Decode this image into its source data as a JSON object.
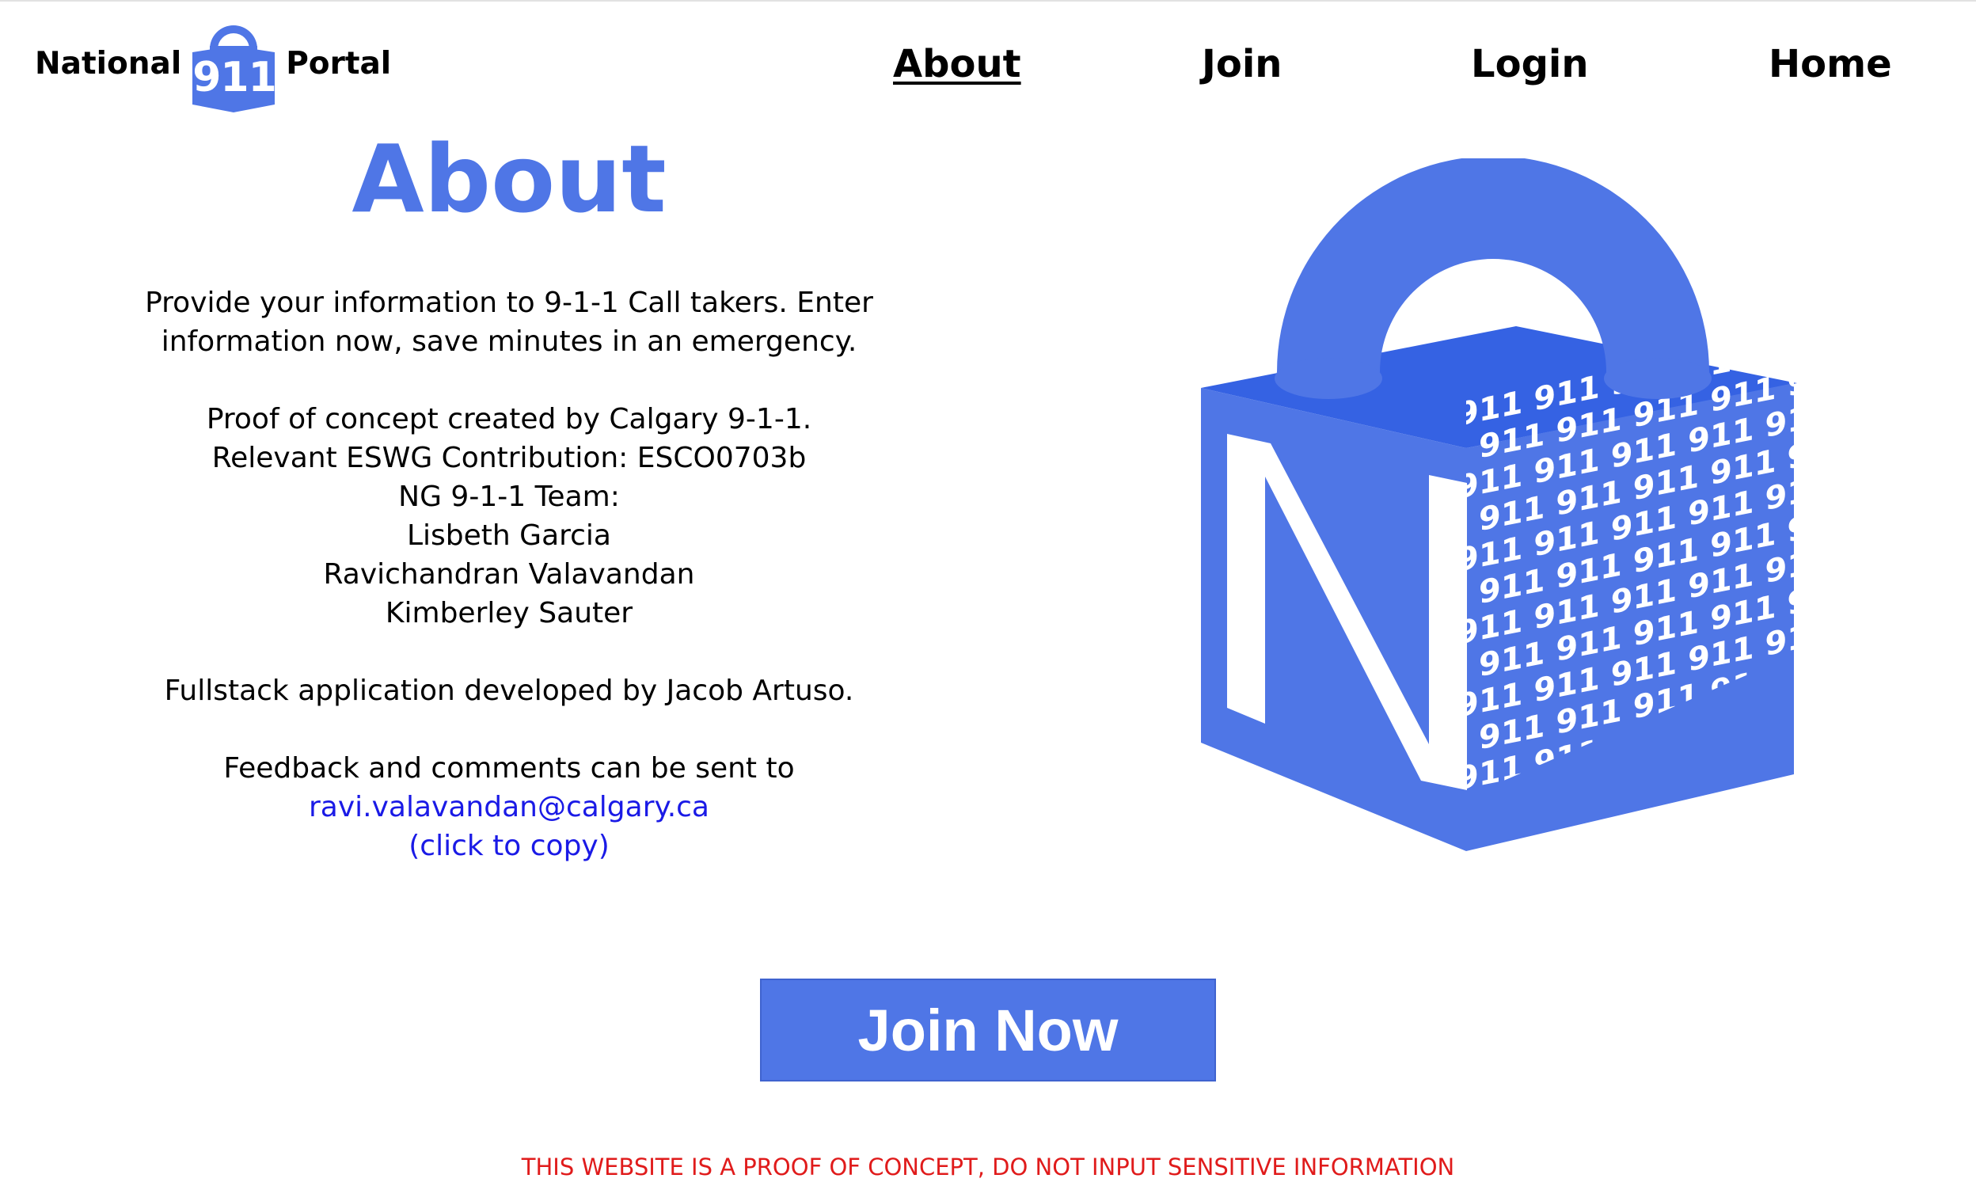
{
  "brand": {
    "word_left": "National",
    "number": "911",
    "word_right": "Portal",
    "color": "#4f76e6"
  },
  "nav": {
    "items": [
      {
        "label": "About",
        "active": true
      },
      {
        "label": "Join",
        "active": false
      },
      {
        "label": "Login",
        "active": false
      },
      {
        "label": "Home",
        "active": false
      }
    ]
  },
  "about": {
    "title": "About",
    "intro": [
      "Provide your information to 9-1-1 Call takers. Enter",
      "information now, save minutes in an emergency."
    ],
    "credits": [
      "Proof of concept created by Calgary 9-1-1.",
      "Relevant ESWG Contribution: ESCO0703b",
      "NG 9-1-1 Team:",
      "Lisbeth Garcia",
      "Ravichandran Valavandan",
      "Kimberley Sauter"
    ],
    "developer": "Fullstack application developed by Jacob Artuso.",
    "feedback_text": "Feedback and comments can be sent to",
    "email": "ravi.valavandan@calgary.ca",
    "copy_hint": "(click to copy)"
  },
  "illustration": {
    "letter": "N",
    "pattern_text": "911 911 911 911 911 911 911",
    "icon": "padlock-cube-illustration"
  },
  "cta": {
    "join_label": "Join Now"
  },
  "footer": {
    "warning": "THIS WEBSITE IS A PROOF OF CONCEPT, DO NOT INPUT SENSITIVE INFORMATION",
    "warning_color": "#e01b1b"
  },
  "colors": {
    "accent": "#4f76e6",
    "accent_dark": "#3562e3",
    "link": "#1a1ae6"
  }
}
